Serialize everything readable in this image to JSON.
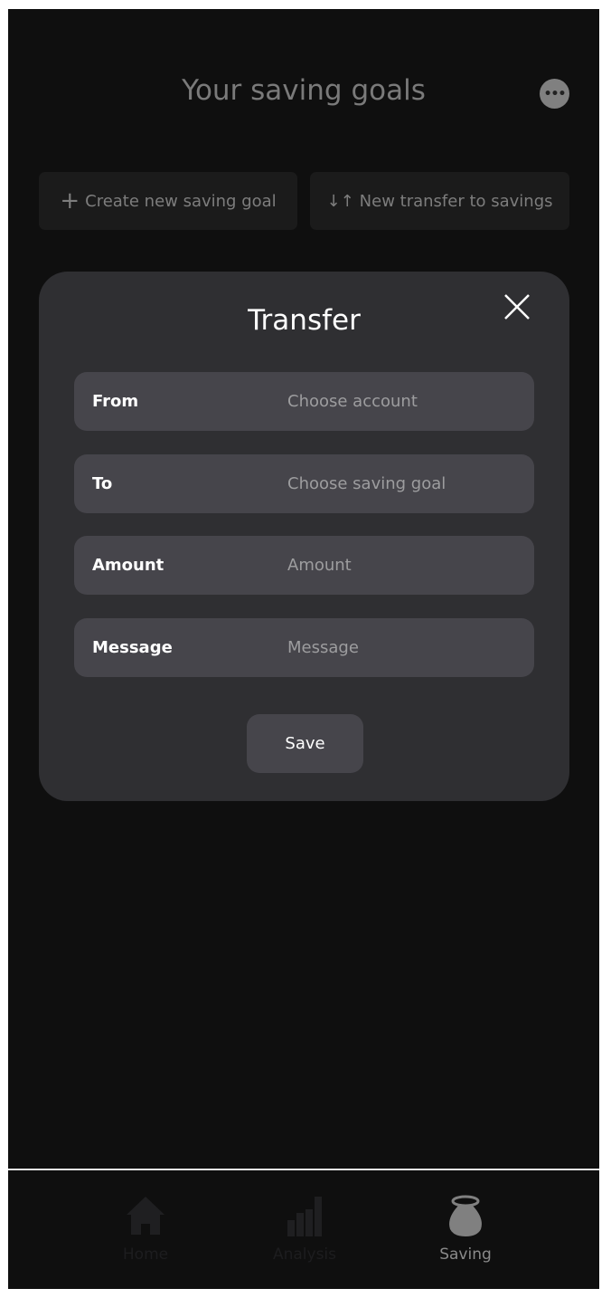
{
  "header": {
    "title": "Your saving goals",
    "more_icon": "ellipsis-icon"
  },
  "actions": {
    "create_goal": {
      "icon": "plus-icon",
      "label": "Create new saving goal"
    },
    "new_transfer": {
      "icon": "↓↑",
      "label": "New transfer to savings"
    }
  },
  "modal": {
    "title": "Transfer",
    "fields": [
      {
        "label": "From",
        "placeholder": "Choose account"
      },
      {
        "label": "To",
        "placeholder": "Choose saving goal"
      },
      {
        "label": "Amount",
        "placeholder": "Amount"
      },
      {
        "label": "Message",
        "placeholder": "Message"
      }
    ],
    "save_label": "Save"
  },
  "bottom_nav": {
    "items": [
      {
        "label": "Home",
        "icon": "home-icon"
      },
      {
        "label": "Analysis",
        "icon": "bar-chart-icon"
      },
      {
        "label": "Saving",
        "icon": "money-bag-icon",
        "active": true
      }
    ]
  }
}
